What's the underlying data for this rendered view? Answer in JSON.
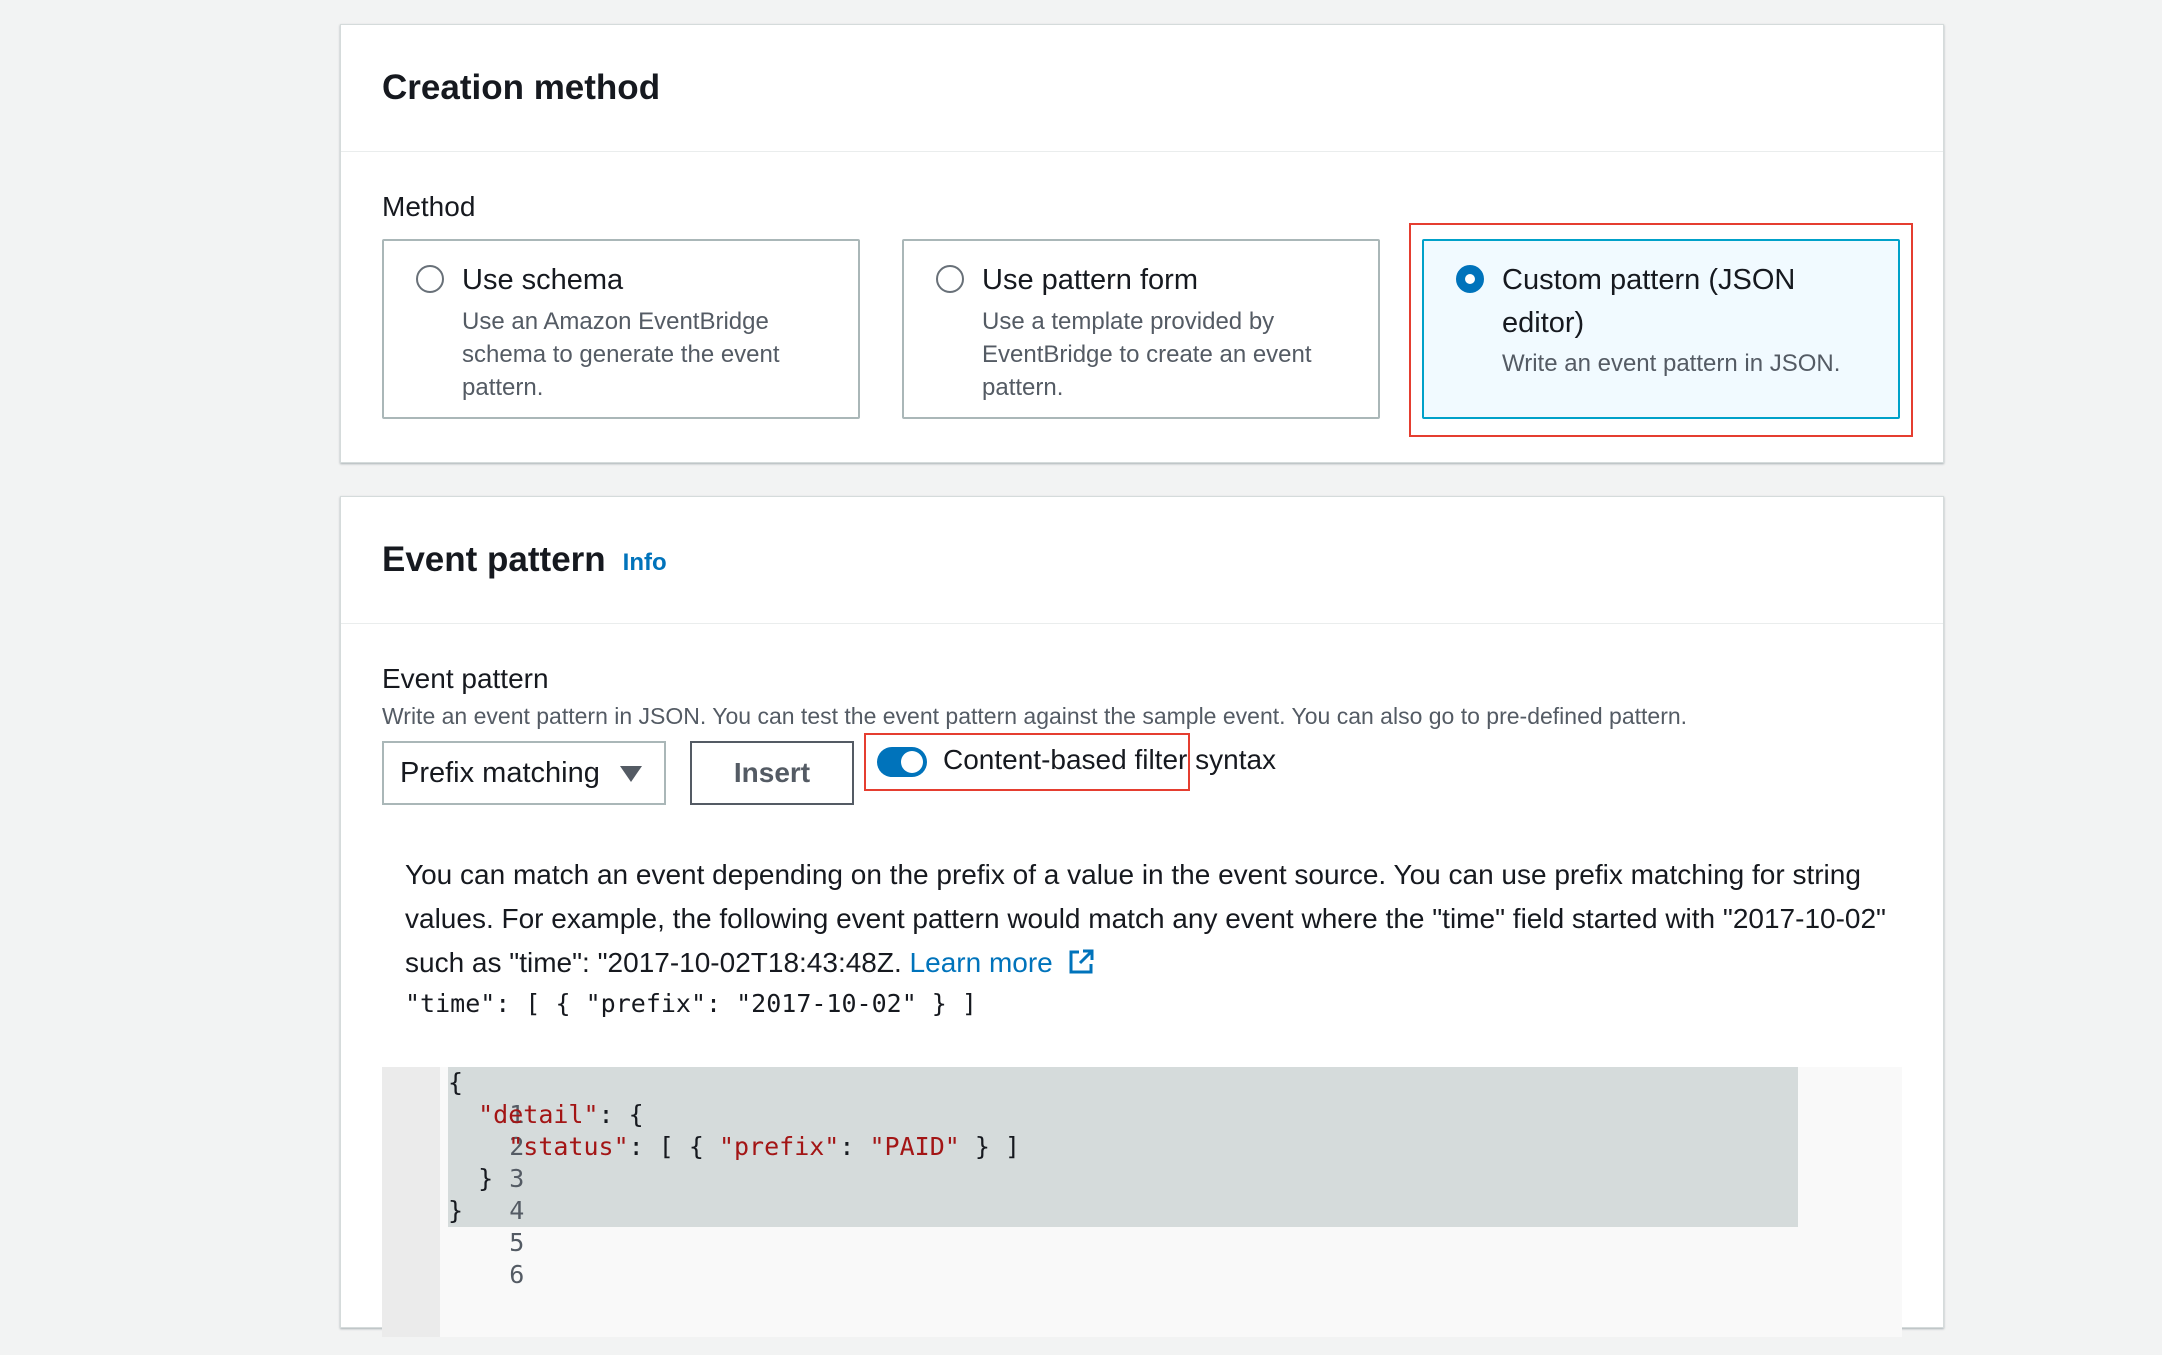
{
  "creation_method": {
    "title": "Creation method",
    "method_label": "Method",
    "options": [
      {
        "title": "Use schema",
        "description": "Use an Amazon EventBridge schema to generate the event pattern.",
        "selected": false
      },
      {
        "title": "Use pattern form",
        "description": "Use a template provided by EventBridge to create an event pattern.",
        "selected": false
      },
      {
        "title": "Custom pattern (JSON editor)",
        "description": "Write an event pattern in JSON.",
        "selected": true
      }
    ]
  },
  "event_pattern": {
    "title": "Event pattern",
    "info_link": "Info",
    "field_label": "Event pattern",
    "field_description": "Write an event pattern in JSON. You can test the event pattern against the sample event. You can also go to pre-defined pattern.",
    "dropdown_value": "Prefix matching",
    "insert_label": "Insert",
    "toggle_label": "Content-based filter syntax",
    "toggle_on": true,
    "help_text": "You can match an event depending on the prefix of a value in the event source. You can use prefix matching for string values. For example, the following event pattern would match any event where the \"time\" field started with \"2017-10-02\" such as \"time\": \"2017-10-02T18:43:48Z.",
    "learn_more": "Learn more",
    "example_code": "\"time\": [ { \"prefix\": \"2017-10-02\" } ]",
    "editor_lines": [
      {
        "num": "1",
        "text": "{"
      },
      {
        "num": "2",
        "text": "  \"detail\": {"
      },
      {
        "num": "3",
        "text": "    \"status\": [ { \"prefix\": \"PAID\" } ]"
      },
      {
        "num": "4",
        "text": "  }"
      },
      {
        "num": "5",
        "text": "}"
      },
      {
        "num": "6",
        "text": ""
      }
    ]
  },
  "colors": {
    "link": "#0073bb",
    "highlight_border": "#e53e30",
    "selected_tile_bg": "#f1faff",
    "selected_tile_border": "#00a1c9"
  }
}
